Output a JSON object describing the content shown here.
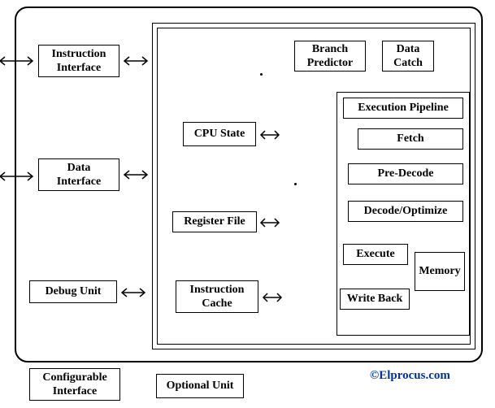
{
  "blocks": {
    "instruction_interface": "Instruction\nInterface",
    "data_interface": "Data\nInterface",
    "debug_unit": "Debug Unit",
    "cpu_state": "CPU State",
    "register_file": "Register File",
    "instruction_cache": "Instruction\nCache",
    "branch_predictor": "Branch\nPredictor",
    "data_catch": "Data\nCatch",
    "execution_pipeline": "Execution Pipeline",
    "fetch": "Fetch",
    "pre_decode": "Pre-Decode",
    "decode_optimize": "Decode/Optimize",
    "execute": "Execute",
    "memory": "Memory",
    "write_back": "Write Back"
  },
  "legend": {
    "configurable_interface": "Configurable\nInterface",
    "optional_unit": "Optional Unit"
  },
  "credit": "©Elprocus.com"
}
